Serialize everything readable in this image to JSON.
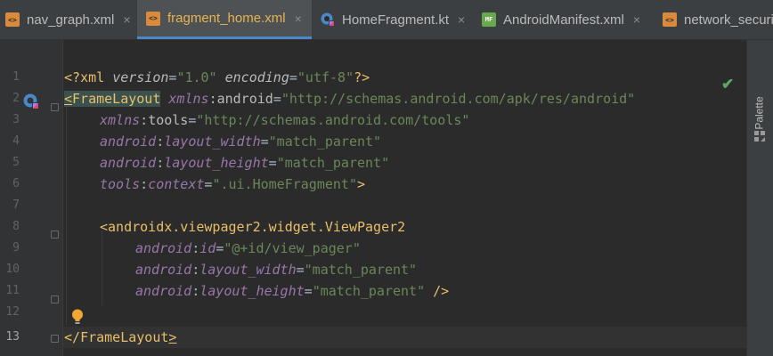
{
  "tabs": [
    {
      "label": "nav_graph.xml",
      "icon": "xml-file-icon",
      "closable": true,
      "active": false
    },
    {
      "label": "fragment_home.xml",
      "icon": "xml-file-icon",
      "closable": true,
      "active": true
    },
    {
      "label": "HomeFragment.kt",
      "icon": "kotlin-file-icon",
      "closable": true,
      "active": false
    },
    {
      "label": "AndroidManifest.xml",
      "icon": "manifest-file-icon",
      "closable": true,
      "active": false
    },
    {
      "label": "network_securit",
      "icon": "xml-file-icon",
      "closable": false,
      "active": false
    }
  ],
  "icon_text": {
    "xml": "<>",
    "mf": "MF"
  },
  "close_glyph": "×",
  "line_numbers": [
    "1",
    "2",
    "3",
    "4",
    "5",
    "6",
    "7",
    "8",
    "9",
    "10",
    "11",
    "12",
    "13"
  ],
  "current_line": "13",
  "code": {
    "l1": {
      "open": "<?",
      "tag": "xml",
      "a1": "version",
      "eq1": "=",
      "v1": "\"1.0\"",
      "a2": "encoding",
      "eq2": "=",
      "v2": "\"utf-8\"",
      "close": "?>"
    },
    "l2": {
      "lt": "<",
      "tag": "FrameLayout",
      "ns": "xmlns",
      "colon": ":",
      "attr": "android",
      "eq": "=",
      "val": "\"http://schemas.android.com/apk/res/android\""
    },
    "l3": {
      "ns": "xmlns",
      "colon": ":",
      "attr": "tools",
      "eq": "=",
      "val": "\"http://schemas.android.com/tools\""
    },
    "l4": {
      "ns": "android",
      "colon": ":",
      "attr": "layout_width",
      "eq": "=",
      "val": "\"match_parent\""
    },
    "l5": {
      "ns": "android",
      "colon": ":",
      "attr": "layout_height",
      "eq": "=",
      "val": "\"match_parent\""
    },
    "l6": {
      "ns": "tools",
      "colon": ":",
      "attr": "context",
      "eq": "=",
      "val": "\".ui.HomeFragment\"",
      "close": ">"
    },
    "l8": {
      "lt": "<",
      "tag": "androidx.viewpager2.widget.ViewPager2"
    },
    "l9": {
      "ns": "android",
      "colon": ":",
      "attr": "id",
      "eq": "=",
      "val": "\"@+id/view_pager\""
    },
    "l10": {
      "ns": "android",
      "colon": ":",
      "attr": "layout_width",
      "eq": "=",
      "val": "\"match_parent\""
    },
    "l11": {
      "ns": "android",
      "colon": ":",
      "attr": "layout_height",
      "eq": "=",
      "val": "\"match_parent\"",
      "close": " />"
    },
    "l13": {
      "open": "</",
      "tag": "FrameLayout",
      "close": ">"
    }
  },
  "sidebar": {
    "palette_label": "Palette"
  },
  "status": {
    "inspection": "no-problems-check-icon"
  }
}
